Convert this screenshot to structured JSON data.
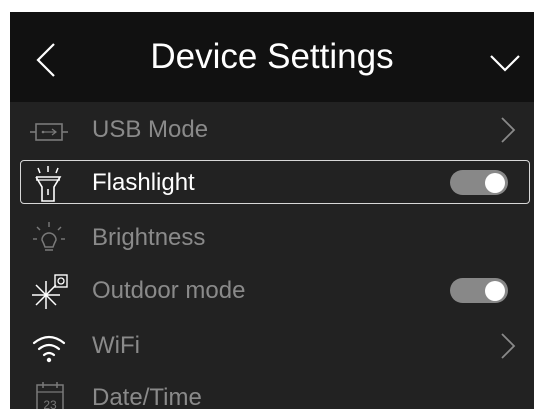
{
  "header": {
    "title": "Device Settings",
    "back_icon": "chevron-left-icon",
    "menu_icon": "chevron-down-icon"
  },
  "items": [
    {
      "label": "USB Mode",
      "icon": "usb-mode-icon",
      "control": "arrow",
      "selected": false
    },
    {
      "label": "Flashlight",
      "icon": "flashlight-icon",
      "control": "toggle",
      "toggle_on": true,
      "selected": true
    },
    {
      "label": "Brightness",
      "icon": "brightness-icon",
      "control": "none",
      "selected": false
    },
    {
      "label": "Outdoor mode",
      "icon": "outdoor-mode-icon",
      "control": "toggle",
      "toggle_on": true,
      "selected": false
    },
    {
      "label": "WiFi",
      "icon": "wifi-icon",
      "control": "arrow",
      "selected": false
    },
    {
      "label": "Date/Time",
      "icon": "calendar-icon",
      "control": "none",
      "selected": false,
      "icon_text": "23"
    }
  ],
  "colors": {
    "background": "#222222",
    "header": "#111111",
    "text_dim": "#8a8a8a",
    "text_active": "#ffffff",
    "toggle_track": "#888888"
  }
}
